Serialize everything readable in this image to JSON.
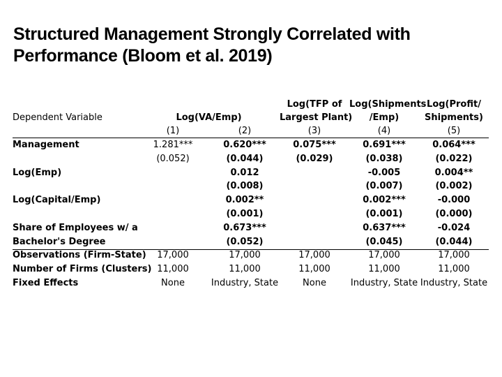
{
  "slide": {
    "title_line1": "Structured Management Strongly Correlated with",
    "title_line2": "Performance (Bloom et al. 2019)"
  },
  "table": {
    "dependent_variable_label": "Dependent Variable",
    "headers": {
      "c12": "Log(VA/Emp)",
      "c3_line1": "Log(TFP of",
      "c3_line2": "Largest Plant)",
      "c4_line1": "Log(Shipments",
      "c4_line2": "/Emp)",
      "c5_line1": "Log(Profit/",
      "c5_line2": "Shipments)"
    },
    "column_numbers": [
      "(1)",
      "(2)",
      "(3)",
      "(4)",
      "(5)"
    ],
    "rows": [
      {
        "label": "Management",
        "cells": [
          "1.281***",
          "0.620***",
          "0.075***",
          "0.691***",
          "0.064***"
        ]
      },
      {
        "label": "",
        "cells": [
          "(0.052)",
          "(0.044)",
          "(0.029)",
          "(0.038)",
          "(0.022)"
        ]
      },
      {
        "label": "Log(Emp)",
        "cells": [
          "",
          "0.012",
          "",
          "-0.005",
          "0.004**"
        ]
      },
      {
        "label": "",
        "cells": [
          "",
          "(0.008)",
          "",
          "(0.007)",
          "(0.002)"
        ]
      },
      {
        "label": "Log(Capital/Emp)",
        "cells": [
          "",
          "0.002**",
          "",
          "0.002***",
          "-0.000"
        ]
      },
      {
        "label": "",
        "cells": [
          "",
          "(0.001)",
          "",
          "(0.001)",
          "(0.000)"
        ]
      },
      {
        "label": "Share of Employees w/ a",
        "cells": [
          "",
          "0.673***",
          "",
          "0.637***",
          "-0.024"
        ]
      },
      {
        "label": "Bachelor's Degree",
        "cells": [
          "",
          "(0.052)",
          "",
          "(0.045)",
          "(0.044)"
        ]
      },
      {
        "label": "Observations (Firm-State)",
        "cells": [
          "17,000",
          "17,000",
          "17,000",
          "17,000",
          "17,000"
        ]
      },
      {
        "label": "Number of Firms (Clusters)",
        "cells": [
          "11,000",
          "11,000",
          "11,000",
          "11,000",
          "11,000"
        ]
      },
      {
        "label": "Fixed Effects",
        "cells": [
          "None",
          "Industry, State",
          "None",
          "Industry, State",
          "Industry, State"
        ]
      }
    ]
  }
}
